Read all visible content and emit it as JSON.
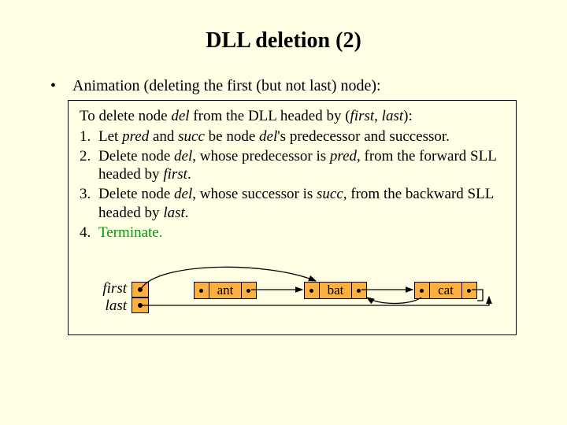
{
  "title": "DLL deletion (2)",
  "bullet": "Animation (deleting the first (but not last) node):",
  "algo": {
    "head_pre": "To delete node ",
    "head_del": "del",
    "head_mid": " from the DLL headed by (",
    "head_first": "first",
    "head_sep": ", ",
    "head_last": "last",
    "head_post": "):",
    "steps": [
      {
        "n": "1.",
        "pre": "Let ",
        "i1": "pred",
        "m1": " and ",
        "i2": "succ",
        "m2": " be node ",
        "i3": "del",
        "post": "'s predecessor and successor."
      },
      {
        "n": "2.",
        "pre": "Delete node ",
        "i1": "del",
        "m1": ", whose predecessor is ",
        "i2": "pred",
        "m2": ", from the forward SLL headed by ",
        "i3": "first",
        "post": "."
      },
      {
        "n": "3.",
        "pre": "Delete node ",
        "i1": "del",
        "m1": ", whose successor is ",
        "i2": "succ",
        "m2": ", from the backward SLL headed by ",
        "i3": "last",
        "post": "."
      },
      {
        "n": "4.",
        "terminate": "Terminate."
      }
    ]
  },
  "diagram": {
    "label_first": "first",
    "label_last": "last",
    "nodes": [
      "ant",
      "bat",
      "cat"
    ]
  }
}
